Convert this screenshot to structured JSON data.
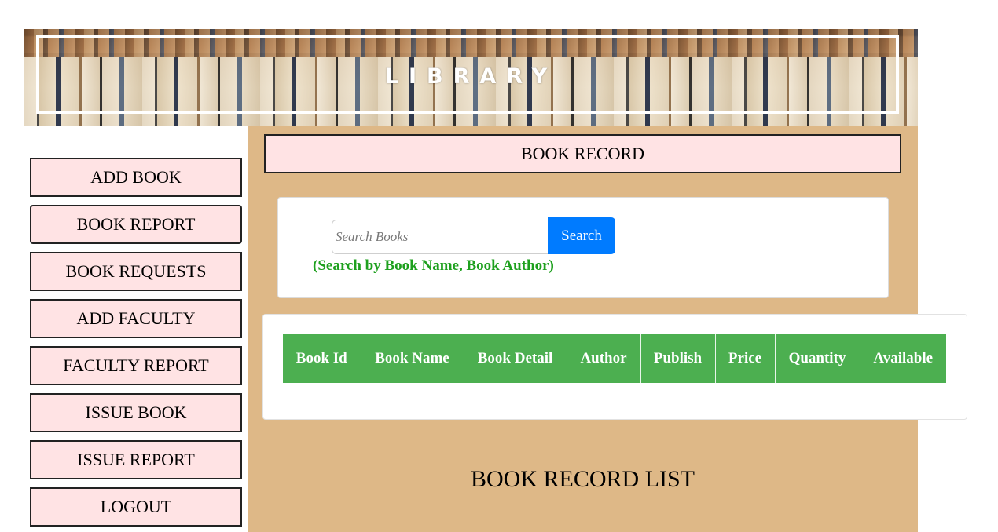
{
  "banner": {
    "title": "LIBRARY"
  },
  "sidebar": {
    "items": [
      {
        "label": "ADD BOOK"
      },
      {
        "label": "BOOK REPORT"
      },
      {
        "label": "BOOK REQUESTS"
      },
      {
        "label": "ADD FACULTY"
      },
      {
        "label": "FACULTY REPORT"
      },
      {
        "label": "ISSUE BOOK"
      },
      {
        "label": "ISSUE REPORT"
      },
      {
        "label": "LOGOUT"
      }
    ]
  },
  "main": {
    "header": "BOOK RECORD",
    "search": {
      "placeholder": "Search Books",
      "value": "",
      "button_label": "Search",
      "hint": "(Search by Book Name, Book Author)"
    },
    "table": {
      "columns": [
        "Book Id",
        "Book Name",
        "Book Detail",
        "Author",
        "Publish",
        "Price",
        "Quantity",
        "Available"
      ],
      "rows": []
    },
    "list_title": "BOOK RECORD LIST"
  },
  "colors": {
    "main_background": "#deb887",
    "button_background": "#ffe3e4",
    "search_button": "#007bff",
    "table_header": "#4caf50",
    "hint_text": "#1ea01e"
  }
}
